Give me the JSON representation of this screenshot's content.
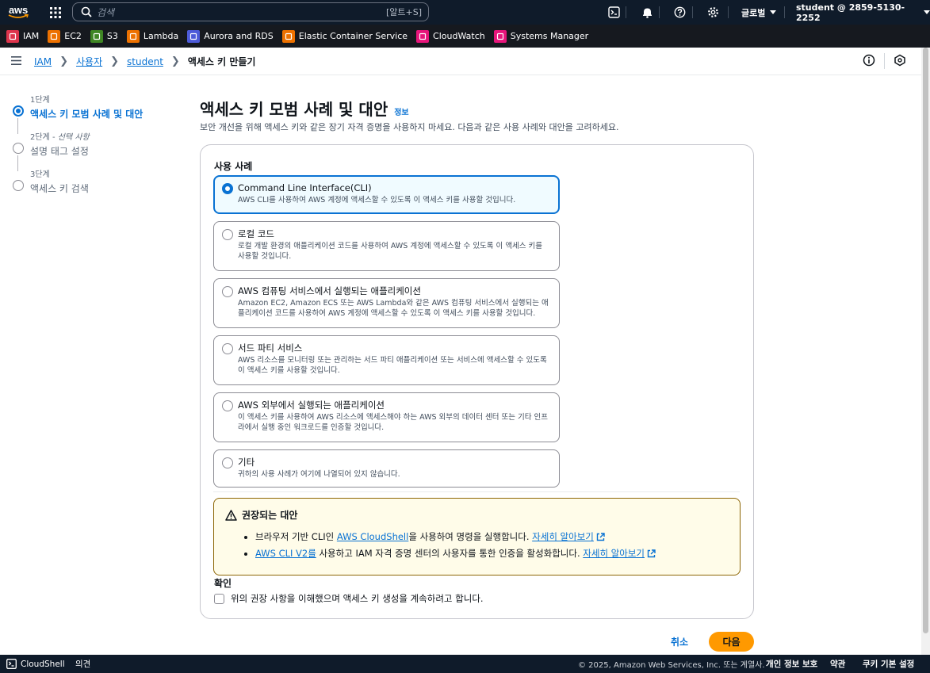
{
  "topnav": {
    "logo_text": "aws",
    "search_placeholder": "검색",
    "search_shortcut": "[알트+S]",
    "region": "글로벌",
    "account": "student @ 2859-5130-2252"
  },
  "favorites": [
    {
      "label": "IAM",
      "color": "#dd344c",
      "icon": "iam-icon"
    },
    {
      "label": "EC2",
      "color": "#ed7100",
      "icon": "ec2-icon"
    },
    {
      "label": "S3",
      "color": "#3f8624",
      "icon": "s3-icon"
    },
    {
      "label": "Lambda",
      "color": "#ed7100",
      "icon": "lambda-icon"
    },
    {
      "label": "Aurora and RDS",
      "color": "#4d5bd9",
      "icon": "rds-icon"
    },
    {
      "label": "Elastic Container Service",
      "color": "#ed7100",
      "icon": "ecs-icon"
    },
    {
      "label": "CloudWatch",
      "color": "#e7157b",
      "icon": "cloudwatch-icon"
    },
    {
      "label": "Systems Manager",
      "color": "#e7157b",
      "icon": "ssm-icon"
    }
  ],
  "breadcrumb": {
    "items": [
      "IAM",
      "사용자",
      "student"
    ],
    "current": "액세스 키 만들기"
  },
  "steps": [
    {
      "label": "1단계",
      "title": "액세스 키 모범 사례 및 대안",
      "optional": "",
      "active": true
    },
    {
      "label": "2단계 - ",
      "optional": "선택 사항",
      "title": "설명 태그 설정",
      "active": false
    },
    {
      "label": "3단계",
      "optional": "",
      "title": "액세스 키 검색",
      "active": false
    }
  ],
  "main": {
    "title": "액세스 키 모범 사례 및 대안",
    "info": "정보",
    "description": "보안 개선을 위해 액세스 키와 같은 장기 자격 증명을 사용하지 마세요. 다음과 같은 사용 사례와 대안을 고려하세요.",
    "use_case_label": "사용 사례",
    "options": [
      {
        "title": "Command Line Interface(CLI)",
        "desc": "AWS CLI를 사용하여 AWS 계정에 액세스할 수 있도록 이 액세스 키를 사용할 것입니다.",
        "selected": true
      },
      {
        "title": "로컬 코드",
        "desc": "로컬 개발 환경의 애플리케이션 코드를 사용하여 AWS 계정에 액세스할 수 있도록 이 액세스 키를 사용할 것입니다.",
        "selected": false
      },
      {
        "title": "AWS 컴퓨팅 서비스에서 실행되는 애플리케이션",
        "desc": "Amazon EC2, Amazon ECS 또는 AWS Lambda와 같은 AWS 컴퓨팅 서비스에서 실행되는 애플리케이션 코드를 사용하여 AWS 계정에 액세스할 수 있도록 이 액세스 키를 사용할 것입니다.",
        "selected": false
      },
      {
        "title": "서드 파티 서비스",
        "desc": "AWS 리소스를 모니터링 또는 관리하는 서드 파티 애플리케이션 또는 서비스에 액세스할 수 있도록 이 액세스 키를 사용할 것입니다.",
        "selected": false
      },
      {
        "title": "AWS 외부에서 실행되는 애플리케이션",
        "desc": "이 액세스 키를 사용하여 AWS 리소스에 액세스해야 하는 AWS 외부의 데이터 센터 또는 기타 인프라에서 실행 중인 워크로드를 인증할 것입니다.",
        "selected": false
      },
      {
        "title": "기타",
        "desc": "귀하의 사용 사례가 여기에 나열되어 있지 않습니다.",
        "selected": false
      }
    ],
    "alert": {
      "title": "권장되는 대안",
      "item1_pre": "브라우저 기반 CLI인 ",
      "item1_link": "AWS CloudShell",
      "item1_post": "을 사용하여 명령을 실행합니다. ",
      "item1_more": "자세히 알아보기",
      "item2_link": "AWS CLI V2를",
      "item2_post": " 사용하고 IAM 자격 증명 센터의 사용자를 통한 인증을 활성화합니다. ",
      "item2_more": "자세히 알아보기"
    },
    "confirm_label": "확인",
    "confirm_text": "위의 권장 사항을 이해했으며 액세스 키 생성을 계속하려고 합니다.",
    "cancel": "취소",
    "next": "다음"
  },
  "footer": {
    "cloudshell": "CloudShell",
    "feedback": "의견",
    "copyright": "© 2025, Amazon Web Services, Inc. 또는 계열사.",
    "privacy": "개인 정보 보호",
    "terms": "약관",
    "cookies": "쿠키 기본 설정"
  }
}
